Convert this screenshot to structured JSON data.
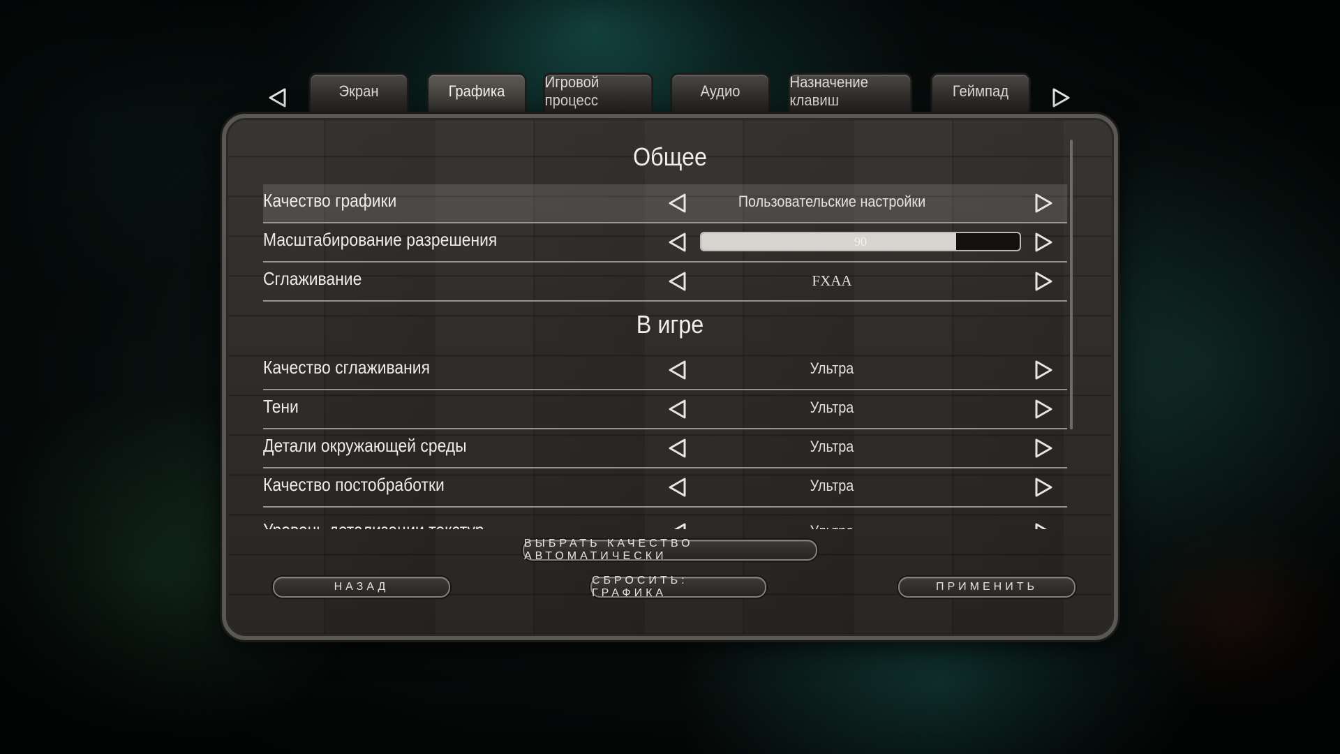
{
  "tabs": [
    {
      "label": "Экран",
      "active": false
    },
    {
      "label": "Графика",
      "active": true
    },
    {
      "label": "Игровой процесс",
      "active": false
    },
    {
      "label": "Аудио",
      "active": false
    },
    {
      "label": "Назначение клавиш",
      "active": false
    },
    {
      "label": "Геймпад",
      "active": false
    }
  ],
  "sections": {
    "general": "Общее",
    "ingame": "В игре"
  },
  "settings": {
    "graphics_quality": {
      "label": "Качество графики",
      "value": "Пользовательские настройки"
    },
    "resolution_scaling": {
      "label": "Масштабирование разрешения",
      "value": "90",
      "fill_percent": 80
    },
    "antialiasing": {
      "label": "Сглаживание",
      "value": "FXAA"
    },
    "antialiasing_quality": {
      "label": "Качество сглаживания",
      "value": "Ультра"
    },
    "shadows": {
      "label": "Тени",
      "value": "Ультра"
    },
    "environment_details": {
      "label": "Детали окружающей среды",
      "value": "Ультра"
    },
    "postprocessing_quality": {
      "label": "Качество постобработки",
      "value": "Ультра"
    },
    "texture_detail": {
      "label": "Уровень детализации текстур",
      "value": "Ультра"
    }
  },
  "buttons": {
    "auto_quality": "ВЫБРАТЬ КАЧЕСТВО АВТОМАТИЧЕСКИ",
    "back": "НАЗАД",
    "reset": "СБРОСИТЬ: ГРАФИКА",
    "apply": "ПРИМЕНИТЬ"
  },
  "icons": {
    "prev": "diamond-arrow-left-icon",
    "next": "diamond-arrow-right-icon"
  },
  "colors": {
    "panel": "#2d2b28",
    "text": "#eeece6",
    "divider": "#a9a69e",
    "slider_fill": "#d6d4cf"
  }
}
